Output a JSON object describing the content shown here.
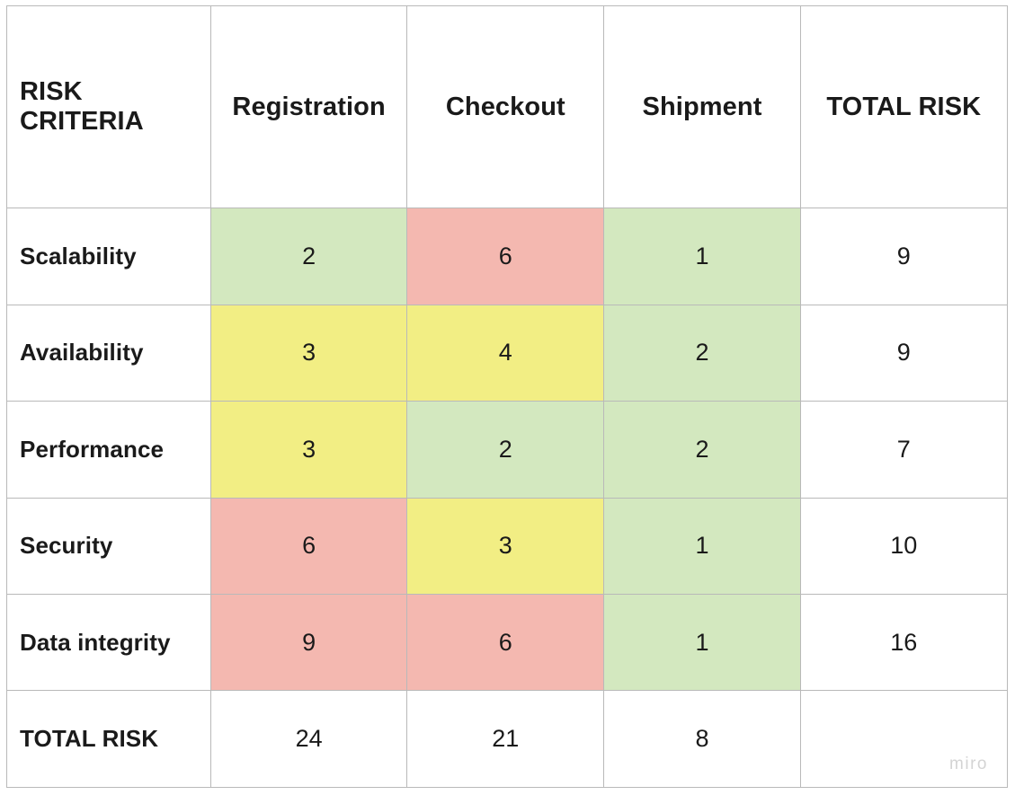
{
  "table": {
    "columns": [
      "RISK CRITERIA",
      "Registration",
      "Checkout",
      "Shipment",
      "TOTAL RISK"
    ],
    "rows": [
      {
        "label": "Scalability",
        "registration": {
          "value": "2",
          "fill": "green"
        },
        "checkout": {
          "value": "6",
          "fill": "red"
        },
        "shipment": {
          "value": "1",
          "fill": "green"
        },
        "total": "9"
      },
      {
        "label": "Availability",
        "registration": {
          "value": "3",
          "fill": "yellow"
        },
        "checkout": {
          "value": "4",
          "fill": "yellow"
        },
        "shipment": {
          "value": "2",
          "fill": "green"
        },
        "total": "9"
      },
      {
        "label": "Performance",
        "registration": {
          "value": "3",
          "fill": "yellow"
        },
        "checkout": {
          "value": "2",
          "fill": "green"
        },
        "shipment": {
          "value": "2",
          "fill": "green"
        },
        "total": "7"
      },
      {
        "label": "Security",
        "registration": {
          "value": "6",
          "fill": "red"
        },
        "checkout": {
          "value": "3",
          "fill": "yellow"
        },
        "shipment": {
          "value": "1",
          "fill": "green"
        },
        "total": "10"
      },
      {
        "label": "Data integrity",
        "registration": {
          "value": "9",
          "fill": "red"
        },
        "checkout": {
          "value": "6",
          "fill": "red"
        },
        "shipment": {
          "value": "1",
          "fill": "green"
        },
        "total": "16"
      }
    ],
    "totals_row": {
      "label": "TOTAL RISK",
      "registration": "24",
      "checkout": "21",
      "shipment": "8",
      "total": ""
    }
  },
  "watermark": {
    "text": "miro"
  },
  "colors": {
    "green": "#d3e8bf",
    "yellow": "#f2ee84",
    "red": "#f4b8b0",
    "border": "#b9b9b9",
    "text": "#1a1a1a",
    "watermark": "#d4d4d4",
    "background": "#ffffff"
  }
}
